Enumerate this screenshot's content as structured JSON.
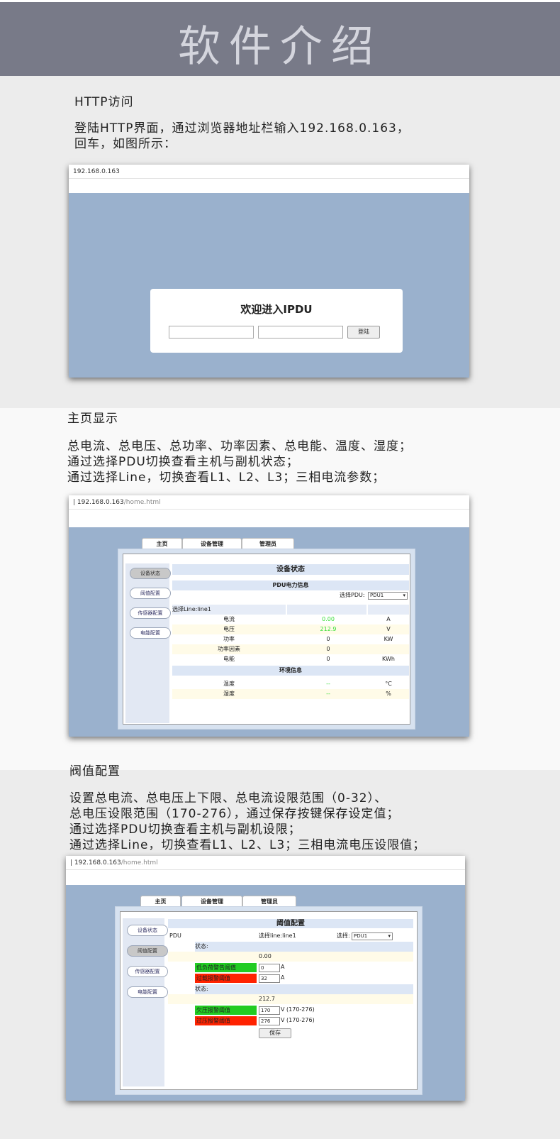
{
  "banner": {
    "title": "软件介绍"
  },
  "section1": {
    "heading": "HTTP访问",
    "text": "登陆HTTP界面，通过浏览器地址栏输入192.168.0.163，\n回车，如图所示：",
    "shot": {
      "address": "192.168.0.163",
      "login_title": "欢迎进入IPDU",
      "login_button": "登陆"
    }
  },
  "section2": {
    "heading": "主页显示",
    "text": "总电流、总电压、总功率、功率因素、总电能、温度、湿度；\n通过选择PDU切换查看主机与副机状态；\n通过选择Line，切换查看L1、L2、L3；三相电流参数；",
    "shot": {
      "address_host": "192.168.0.163",
      "address_path": "/home.html",
      "tabs": [
        "主页",
        "设备管理",
        "管理员"
      ],
      "sidebar": [
        "设备状态",
        "阈值配置",
        "传感器配置",
        "电能配置"
      ],
      "title": "设备状态",
      "pdu_info": "PDU电力信息",
      "select_pdu_label": "选择PDU:",
      "select_pdu_value": "PDU1",
      "select_line": "选择Line:line1",
      "rows": [
        {
          "label": "电流",
          "value": "0.00",
          "unit": "A"
        },
        {
          "label": "电压",
          "value": "212.9",
          "unit": "V"
        },
        {
          "label": "功率",
          "value": "0",
          "unit": "KW"
        },
        {
          "label": "功率因素",
          "value": "0",
          "unit": ""
        },
        {
          "label": "电能",
          "value": "0",
          "unit": "KWh"
        }
      ],
      "env_info": "环境信息",
      "env_rows": [
        {
          "label": "温度",
          "value": "--",
          "unit": "°C"
        },
        {
          "label": "湿度",
          "value": "--",
          "unit": "%"
        }
      ]
    }
  },
  "section3": {
    "heading": "阀值配置",
    "text": "设置总电流、总电压上下限、总电流设限范围（0-32）、\n总电压设限范围（170-276），通过保存按键保存设定值；\n通过选择PDU切换查看主机与副机设限；\n通过选择Line，切换查看L1、L2、L3；三相电流电压设限值；",
    "shot": {
      "address_host": "192.168.0.163",
      "address_path": "/home.html",
      "tabs": [
        "主页",
        "设备管理",
        "管理员"
      ],
      "sidebar": [
        "设备状态",
        "阈值配置",
        "传感器配置",
        "电能配置"
      ],
      "title": "阈值配置",
      "pdu_label": "PDU",
      "select_line": "选择line:line1",
      "select_label": "选择:",
      "select_value": "PDU1",
      "status_label": "状态:",
      "current_value": "0.00",
      "low_load_label": "低负荷警告阈值",
      "low_load_value": "0",
      "low_load_unit": "A",
      "overload_label": "过载报警阈值",
      "overload_value": "32",
      "overload_unit": "A",
      "status_label2": "状态:",
      "voltage_value": "212.7",
      "under_volt_label": "欠压报警阈值",
      "under_volt_value": "170",
      "under_volt_unit": "V (170-276)",
      "over_volt_label": "过压报警阈值",
      "over_volt_value": "276",
      "over_volt_unit": "V (170-276)",
      "save_button": "保存"
    }
  },
  "colors": {
    "banner": "#787a88",
    "screen_bg": "#9ab1cd",
    "green_label": "#22cc22",
    "red_label": "#ff2200",
    "value_green": "#33dd33"
  }
}
